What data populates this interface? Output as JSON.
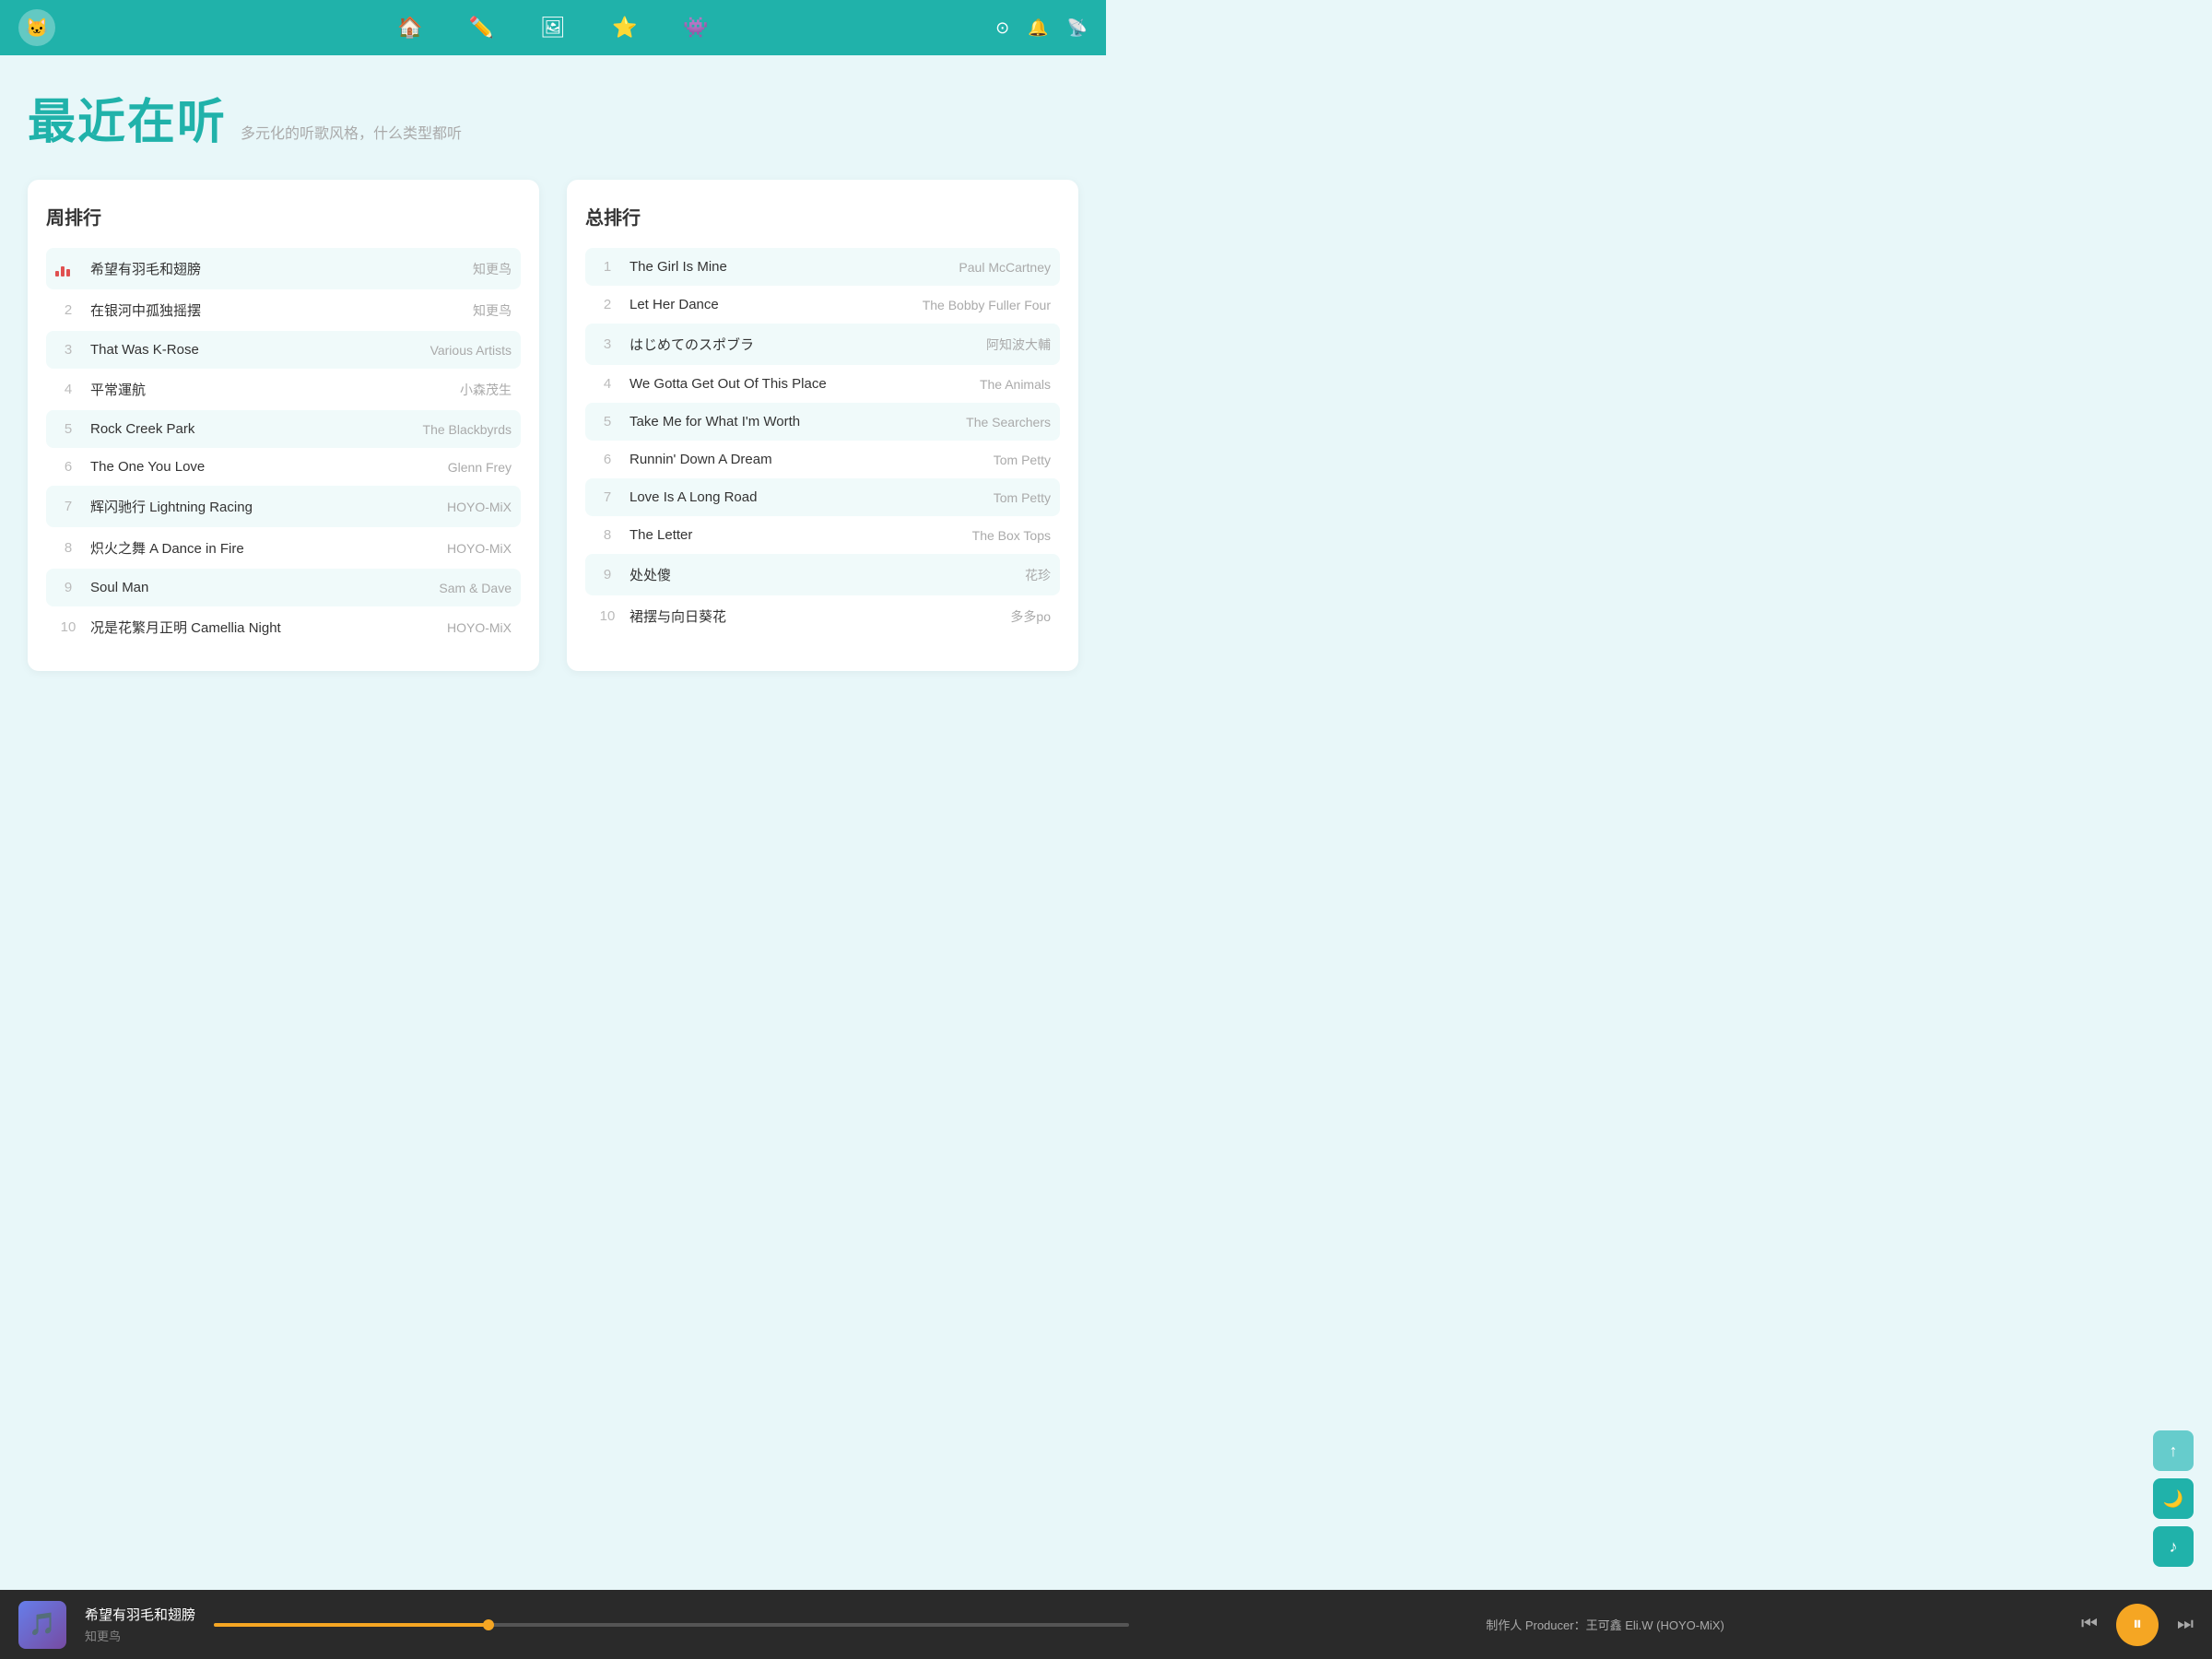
{
  "header": {
    "logo_icon": "🐱",
    "nav": [
      {
        "label": "🏠",
        "name": "home"
      },
      {
        "label": "✏️",
        "name": "edit"
      },
      {
        "label": "🖼",
        "name": "gallery"
      },
      {
        "label": "⭐",
        "name": "favorites"
      },
      {
        "label": "👾",
        "name": "game"
      }
    ],
    "right_icons": [
      "github-icon",
      "bell-icon",
      "rss-icon"
    ]
  },
  "page": {
    "title": "最近在听",
    "subtitle": "多元化的听歌风格，什么类型都听"
  },
  "weekly_chart": {
    "title": "周排行",
    "items": [
      {
        "rank": "♦",
        "title": "希望有羽毛和翅膀",
        "artist": "知更鸟",
        "active": true
      },
      {
        "rank": "2",
        "title": "在银河中孤独摇摆",
        "artist": "知更鸟",
        "active": false
      },
      {
        "rank": "3",
        "title": "That Was K-Rose",
        "artist": "Various Artists",
        "active": false
      },
      {
        "rank": "4",
        "title": "平常運航",
        "artist": "小森茂生",
        "active": false
      },
      {
        "rank": "5",
        "title": "Rock Creek Park",
        "artist": "The Blackbyrds",
        "active": false
      },
      {
        "rank": "6",
        "title": "The One You Love",
        "artist": "Glenn Frey",
        "active": false
      },
      {
        "rank": "7",
        "title": "辉闪驰行 Lightning Racing",
        "artist": "HOYO-MiX",
        "active": false
      },
      {
        "rank": "8",
        "title": "炽火之舞 A Dance in Fire",
        "artist": "HOYO-MiX",
        "active": false
      },
      {
        "rank": "9",
        "title": "Soul Man",
        "artist": "Sam & Dave",
        "active": false
      },
      {
        "rank": "10",
        "title": "况是花繁月正明 Camellia Night",
        "artist": "HOYO-MiX",
        "active": false
      }
    ]
  },
  "total_chart": {
    "title": "总排行",
    "items": [
      {
        "rank": "1",
        "title": "The Girl Is Mine",
        "artist": "Paul McCartney"
      },
      {
        "rank": "2",
        "title": "Let Her Dance",
        "artist": "The Bobby Fuller Four"
      },
      {
        "rank": "3",
        "title": "はじめてのスポブラ",
        "artist": "阿知波大輔"
      },
      {
        "rank": "4",
        "title": "We Gotta Get Out Of This Place",
        "artist": "The Animals"
      },
      {
        "rank": "5",
        "title": "Take Me for What I'm Worth",
        "artist": "The Searchers"
      },
      {
        "rank": "6",
        "title": "Runnin' Down A Dream",
        "artist": "Tom Petty"
      },
      {
        "rank": "7",
        "title": "Love Is A Long Road",
        "artist": "Tom Petty"
      },
      {
        "rank": "8",
        "title": "The Letter",
        "artist": "The Box Tops"
      },
      {
        "rank": "9",
        "title": "处处傻",
        "artist": "花珍"
      },
      {
        "rank": "10",
        "title": "裙摆与向日葵花",
        "artist": "多多po"
      }
    ]
  },
  "player": {
    "song": "希望有羽毛和翅膀",
    "artist": "知更鸟",
    "track_info": "制作人 Producer：王可鑫 Eli.W (HOYO-MiX)"
  },
  "float_buttons": [
    {
      "label": "↑",
      "name": "scroll-up-button"
    },
    {
      "label": "🌙",
      "name": "dark-mode-button"
    },
    {
      "label": "♪",
      "name": "music-button"
    }
  ]
}
